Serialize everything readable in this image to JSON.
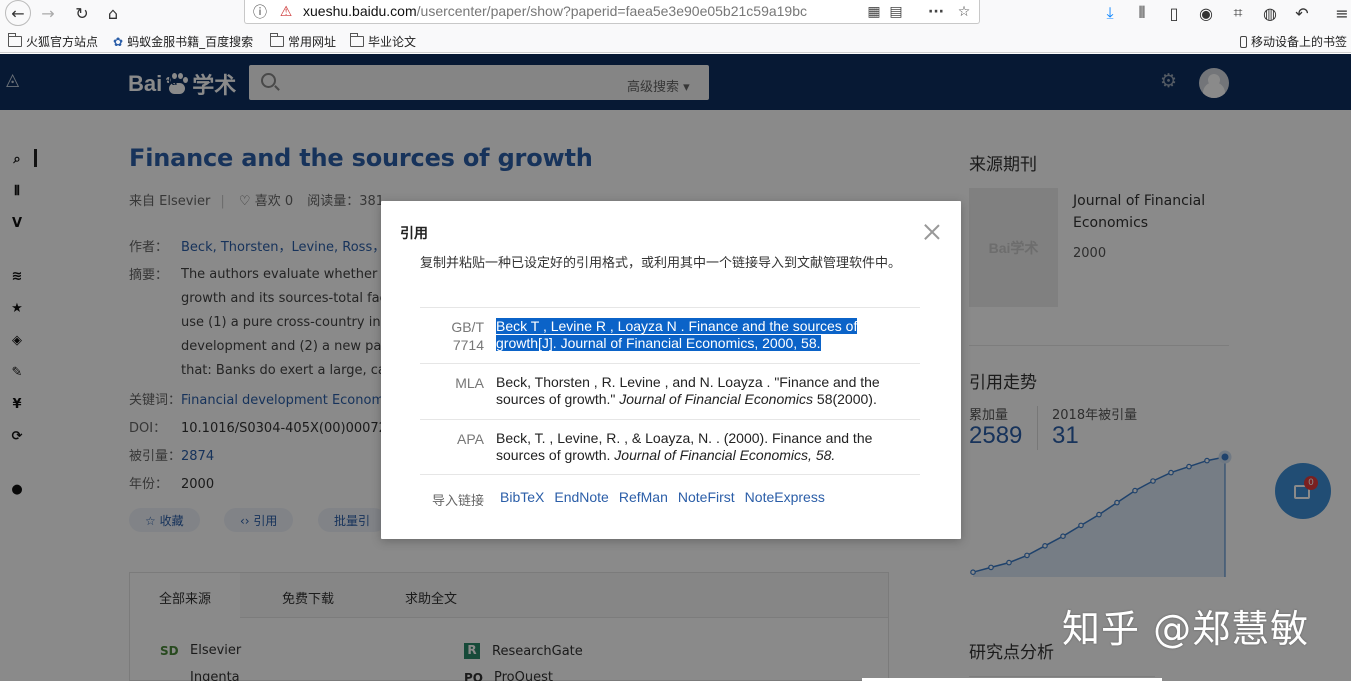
{
  "browser": {
    "url_host": "xueshu.baidu.com",
    "url_path": "/usercenter/paper/show?paperid=faea5e3e90e05b21c59a19bc",
    "bookmarks": [
      "火狐官方站点",
      "蚂蚁金服书籍_百度搜索",
      "常用网址",
      "毕业论文"
    ],
    "mobile_bookmarks": "移动设备上的书签"
  },
  "site": {
    "logo_text_left": "Bai",
    "logo_text_mid": "du",
    "logo_text_right": "学术",
    "advanced_search": "高级搜索 ▾"
  },
  "paper": {
    "title": "Finance and the sources of growth",
    "source": "来自 Elsevier",
    "likes": "♡ 喜欢 0",
    "reads": "阅读量：381",
    "authors_label": "作者：",
    "authors": "Beck, Thorsten，Levine, Ross，L",
    "abstract_label": "摘要：",
    "abstract_lines": [
      "The authors evaluate whether th",
      "growth and its sources-total fact",
      "use (1) a pure cross-country inst",
      "development and (2) a new pane",
      "that: Banks do exert a large, caus"
    ],
    "keywords_label": "关键词：",
    "keywords": "Financial development  Econom",
    "doi_label": "DOI：",
    "doi": "10.1016/S0304-405X(00)00072-6",
    "cited_label": "被引量：",
    "cited": "2874",
    "year_label": "年份：",
    "year": "2000",
    "actions": [
      "☆ 收藏",
      "‹› 引用",
      "批量引"
    ]
  },
  "sources": {
    "tabs": [
      "全部来源",
      "免费下载",
      "求助全文"
    ],
    "items": [
      {
        "badge": "SD",
        "name": "Elsevier"
      },
      {
        "badge": "R",
        "name": "ResearchGate"
      },
      {
        "badge": "",
        "name": "Ingenta"
      },
      {
        "badge": "PQ",
        "name": "ProQuest"
      }
    ]
  },
  "sidebar": {
    "journal_heading": "来源期刊",
    "journal_name": "Journal of Financial Economics",
    "journal_year": "2000",
    "journal_logo": "Bai学术",
    "trend_heading": "引用走势",
    "total_label": "累加量",
    "total_value": "2589",
    "year_label": "2018年被引量",
    "year_value": "31",
    "analysis_heading": "研究点分析",
    "fab_badge": "0"
  },
  "chart_data": {
    "type": "area",
    "title": "",
    "values": [
      0.04,
      0.08,
      0.12,
      0.18,
      0.26,
      0.34,
      0.43,
      0.52,
      0.62,
      0.72,
      0.8,
      0.87,
      0.92,
      0.97,
      1.0
    ]
  },
  "modal": {
    "title": "引用",
    "description": "复制并粘贴一种已设定好的引用格式，或利用其中一个链接导入到文献管理软件中。",
    "citations": [
      {
        "format": "GB/T 7714",
        "text": "Beck T , Levine R , Loayza N . Finance and the sources of growth[J]. Journal of Financial Economics, 2000, 58."
      },
      {
        "format": "MLA",
        "text_before": "Beck, Thorsten , R. Levine , and N. Loayza . \"Finance and the sources of growth.\" ",
        "journal": "Journal of Financial Economics",
        "text_after": " 58(2000)."
      },
      {
        "format": "APA",
        "text_before": "Beck, T. , Levine, R. , & Loayza, N. . (2000). Finance and the sources of growth. ",
        "journal": "Journal of Financial Economics, 58.",
        "text_after": ""
      }
    ],
    "import_label": "导入链接",
    "import_links": [
      "BibTeX",
      "EndNote",
      "RefMan",
      "NoteFirst",
      "NoteExpress"
    ]
  },
  "watermark": "知乎 @郑慧敏"
}
